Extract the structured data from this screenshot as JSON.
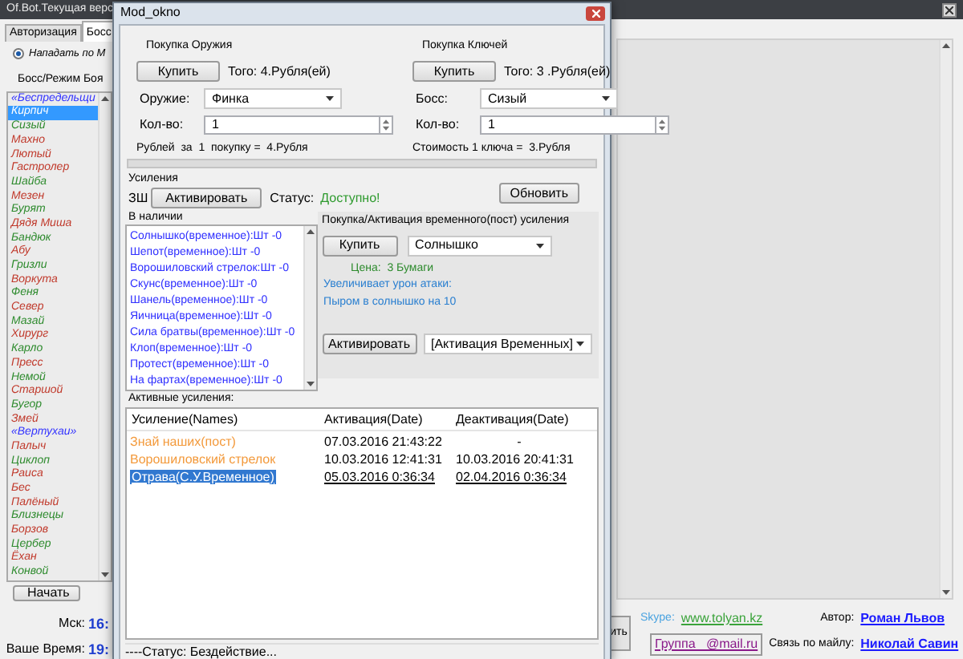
{
  "main_window": {
    "title": "Of.Bot.Текущая верс",
    "tabs": [
      {
        "label": "Авторизация",
        "selected": false
      },
      {
        "label": "Босс",
        "selected": true
      }
    ],
    "attack_option": {
      "label": "Нападать по М",
      "selected": true
    },
    "boss_list": {
      "header": "Босс/Режим Боя",
      "items": [
        {
          "name": "«Беспредельщи",
          "color": "#3333ff",
          "selected": false
        },
        {
          "name": "Кирпич",
          "selected": true
        },
        {
          "name": "Сизый",
          "color": "#2e8b2e",
          "selected": false
        },
        {
          "name": "Махно",
          "color": "#c0392b",
          "selected": false
        },
        {
          "name": "Лютый",
          "color": "#c0392b",
          "selected": false
        },
        {
          "name": "Гастролер",
          "color": "#c0392b",
          "selected": false
        },
        {
          "name": "Шайба",
          "color": "#2e8b2e",
          "selected": false
        },
        {
          "name": "Мезен",
          "color": "#c0392b",
          "selected": false
        },
        {
          "name": "Бурят",
          "color": "#2e8b2e",
          "selected": false
        },
        {
          "name": "Дядя Миша",
          "color": "#c0392b",
          "selected": false
        },
        {
          "name": "Бандюк",
          "color": "#2e8b2e",
          "selected": false
        },
        {
          "name": "Абу",
          "color": "#c0392b",
          "selected": false
        },
        {
          "name": "Гризли",
          "color": "#2e8b2e",
          "selected": false
        },
        {
          "name": "Воркута",
          "color": "#c0392b",
          "selected": false
        },
        {
          "name": "Феня",
          "color": "#2e8b2e",
          "selected": false
        },
        {
          "name": "Север",
          "color": "#c0392b",
          "selected": false
        },
        {
          "name": "Мазай",
          "color": "#2e8b2e",
          "selected": false
        },
        {
          "name": "Хирург",
          "color": "#c0392b",
          "selected": false
        },
        {
          "name": "Карло",
          "color": "#2e8b2e",
          "selected": false
        },
        {
          "name": "Пресс",
          "color": "#c0392b",
          "selected": false
        },
        {
          "name": "Немой",
          "color": "#2e8b2e",
          "selected": false
        },
        {
          "name": "Старшой",
          "color": "#c0392b",
          "selected": false
        },
        {
          "name": "Бугор",
          "color": "#2e8b2e",
          "selected": false
        },
        {
          "name": "Змей",
          "color": "#c0392b",
          "selected": false
        },
        {
          "name": "«Вертухаи»",
          "color": "#3333ff",
          "selected": false
        },
        {
          "name": "Палыч",
          "color": "#c0392b",
          "selected": false
        },
        {
          "name": "Циклоп",
          "color": "#2e8b2e",
          "selected": false
        },
        {
          "name": "Раиса",
          "color": "#c0392b",
          "selected": false
        },
        {
          "name": "Бес",
          "color": "#c0392b",
          "selected": false
        },
        {
          "name": "Палёный",
          "color": "#c0392b",
          "selected": false
        },
        {
          "name": "Близнецы",
          "color": "#2e8b2e",
          "selected": false
        },
        {
          "name": "Борзов",
          "color": "#c0392b",
          "selected": false
        },
        {
          "name": "Цербер",
          "color": "#2e8b2e",
          "selected": false
        },
        {
          "name": "Ёхан",
          "color": "#c0392b",
          "selected": false
        },
        {
          "name": "Конвой",
          "color": "#2e8b2e",
          "selected": false
        }
      ]
    },
    "start_button": "Начать",
    "clock": [
      {
        "label": "Мск:",
        "value": "16:"
      },
      {
        "label": "Ваше Время:",
        "value": "19:"
      }
    ],
    "partial_button": "ить",
    "footer": {
      "skype_label": "Skype:",
      "skype_link": "www.tolyan.kz",
      "group_link": "Группа _@mail.ru",
      "author_label": "Автор:",
      "author_link": "Роман Львов",
      "mail_label": "Связь по майлу:",
      "mail_link": "Николай Савин"
    }
  },
  "dialog": {
    "title": "Mod_okno",
    "purchases": [
      {
        "title": "Покупка Оружия",
        "buy_button": "Купить",
        "total": "Того: 4.Рубля(ей)",
        "select_label": "Оружие:",
        "select_value": "Финка",
        "qty_label": "Кол-во:",
        "qty_value": "1",
        "summary": "Рублей  за  1  покупку =  4.Рубля"
      },
      {
        "title": "Покупка Ключей",
        "buy_button": "Купить",
        "total": "Того: 3 .Рубля(ей)",
        "select_label": "Босс:",
        "select_value": "Сизый",
        "qty_label": "Кол-во:",
        "qty_value": "1",
        "summary": "Стоимость 1 ключа =  3.Рубля"
      }
    ],
    "boosts": {
      "title": "Усиления",
      "code": "ЗШ",
      "activate_button": "Активировать",
      "status_label": "Статус:",
      "status_value": "Доступно!",
      "refresh_button": "Обновить",
      "inventory_label": "В наличии",
      "inventory": [
        "Солнышко(временное):Шт -0",
        "Шепот(временное):Шт -0",
        "Ворошиловский стрелок:Шт -0",
        "Скунс(временное):Шт -0",
        "Шанель(временное):Шт -0",
        "Яичница(временное):Шт -0",
        "Сила братвы(временное):Шт -0",
        "Клоп(временное):Шт -0",
        "Протест(временное):Шт -0",
        "На фартах(временное):Шт -0"
      ],
      "shop": {
        "title": "Покупка/Активация временного(пост) усиления",
        "buy_button": "Купить",
        "buy_select": "Солнышко",
        "price": "Цена:  3 Бумаги",
        "description": [
          "Увеличивает урон атаки:",
          "Пыром в солнышко на 10"
        ],
        "activate_button": "Активировать",
        "activate_select": "[Активация Временных]"
      }
    },
    "active": {
      "title": "Активные усиления:",
      "columns": [
        "Усиление(Names)",
        "Активация(Date)",
        "Деактивация(Date)"
      ],
      "rows": [
        {
          "cells": [
            "Знай наших(пост)",
            "07.03.2016 21:43:22",
            "-"
          ],
          "color": "#f39a3c",
          "selected": false
        },
        {
          "cells": [
            "Ворошиловский стрелок",
            "10.03.2016 12:41:31",
            "10.03.2016 20:41:31"
          ],
          "color": "#f39a3c",
          "selected": false
        },
        {
          "cells": [
            "Отрава(С.У.Временное)",
            "05.03.2016 0:36:34",
            "02.04.2016 0:36:34"
          ],
          "color": "#ffffff",
          "selected": true
        }
      ]
    },
    "status": "----Статус: Бездействие..."
  }
}
